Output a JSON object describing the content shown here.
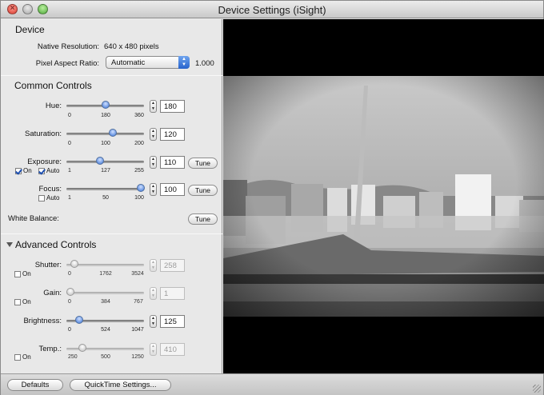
{
  "window": {
    "title": "Device Settings (iSight)"
  },
  "device": {
    "section_title": "Device",
    "native_resolution_label": "Native Resolution:",
    "native_resolution_value": "640 x 480 pixels",
    "pixel_aspect_label": "Pixel Aspect Ratio:",
    "pixel_aspect_value": "Automatic",
    "pixel_aspect_number": "1.000"
  },
  "common": {
    "section_title": "Common Controls",
    "hue": {
      "label": "Hue:",
      "value": "180",
      "ticks": [
        "0",
        "180",
        "360"
      ],
      "level": 0.5
    },
    "saturation": {
      "label": "Saturation:",
      "value": "120",
      "ticks": [
        "0",
        "100",
        "200"
      ],
      "level": 0.6
    },
    "exposure": {
      "label": "Exposure:",
      "value": "110",
      "ticks": [
        "1",
        "127",
        "255"
      ],
      "level": 0.43,
      "on_label": "On",
      "auto_label": "Auto",
      "tune_label": "Tune"
    },
    "focus": {
      "label": "Focus:",
      "value": "100",
      "ticks": [
        "1",
        "50",
        "100"
      ],
      "level": 1.0,
      "auto_label": "Auto",
      "tune_label": "Tune"
    },
    "white_balance": {
      "label": "White Balance:",
      "tune_label": "Tune"
    }
  },
  "advanced": {
    "section_title": "Advanced Controls",
    "shutter": {
      "label": "Shutter:",
      "value": "258",
      "ticks": [
        "0",
        "1762",
        "3524"
      ],
      "level": 0.07,
      "on_label": "On"
    },
    "gain": {
      "label": "Gain:",
      "value": "1",
      "ticks": [
        "0",
        "384",
        "767"
      ],
      "level": 0.0,
      "on_label": "On"
    },
    "brightness": {
      "label": "Brightness:",
      "value": "125",
      "ticks": [
        "0",
        "524",
        "1047"
      ],
      "level": 0.12
    },
    "temp": {
      "label": "Temp.:",
      "value": "410",
      "ticks": [
        "250",
        "500",
        "1250"
      ],
      "level": 0.16,
      "on_label": "On"
    }
  },
  "bottom": {
    "defaults_label": "Defaults",
    "quicktime_label": "QuickTime Settings..."
  }
}
